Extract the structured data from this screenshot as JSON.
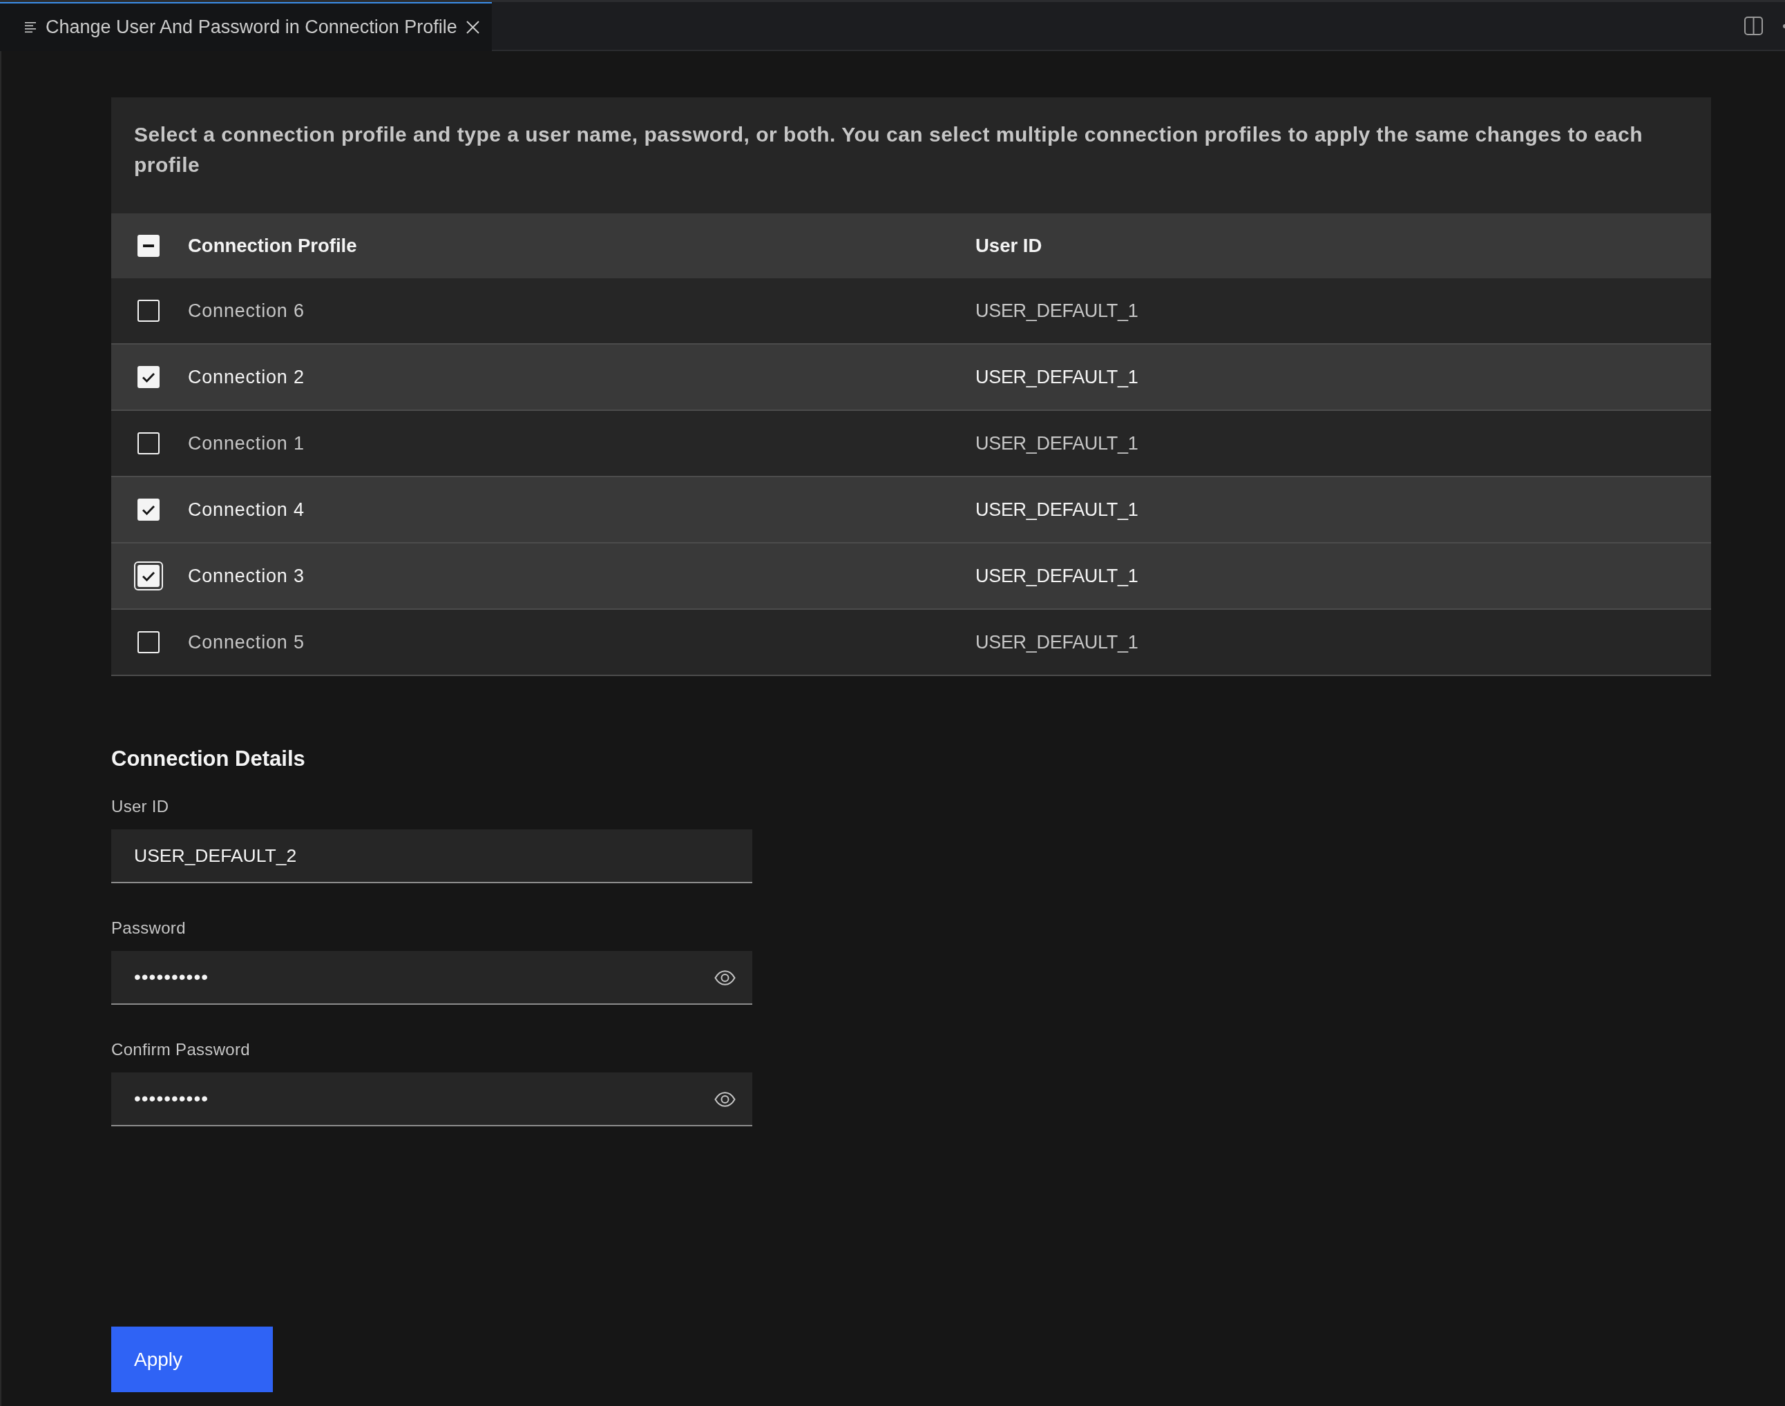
{
  "tab": {
    "title": "Change User And Password in Connection Profile"
  },
  "description": "Select a connection profile and type a user name, password, or both. You can select multiple connection profiles to apply the same changes to each profile",
  "table": {
    "select_all": {
      "indeterminate": true
    },
    "columns": [
      "Connection Profile",
      "User ID"
    ],
    "rows": [
      {
        "connection_profile": "Connection 6",
        "user_id": "USER_DEFAULT_1",
        "selected": false,
        "focused": false
      },
      {
        "connection_profile": "Connection 2",
        "user_id": "USER_DEFAULT_1",
        "selected": true,
        "focused": false
      },
      {
        "connection_profile": "Connection 1",
        "user_id": "USER_DEFAULT_1",
        "selected": false,
        "focused": false
      },
      {
        "connection_profile": "Connection 4",
        "user_id": "USER_DEFAULT_1",
        "selected": true,
        "focused": false
      },
      {
        "connection_profile": "Connection 3",
        "user_id": "USER_DEFAULT_1",
        "selected": true,
        "focused": true
      },
      {
        "connection_profile": "Connection 5",
        "user_id": "USER_DEFAULT_1",
        "selected": false,
        "focused": false
      }
    ]
  },
  "details": {
    "title": "Connection Details",
    "fields": [
      {
        "kind": "text",
        "label": "User ID",
        "value": "USER_DEFAULT_2"
      },
      {
        "kind": "password",
        "label": "Password",
        "value": "••••••••••"
      },
      {
        "kind": "password",
        "label": "Confirm Password",
        "value": "••••••••••"
      }
    ]
  },
  "apply_button": {
    "label": "Apply"
  }
}
